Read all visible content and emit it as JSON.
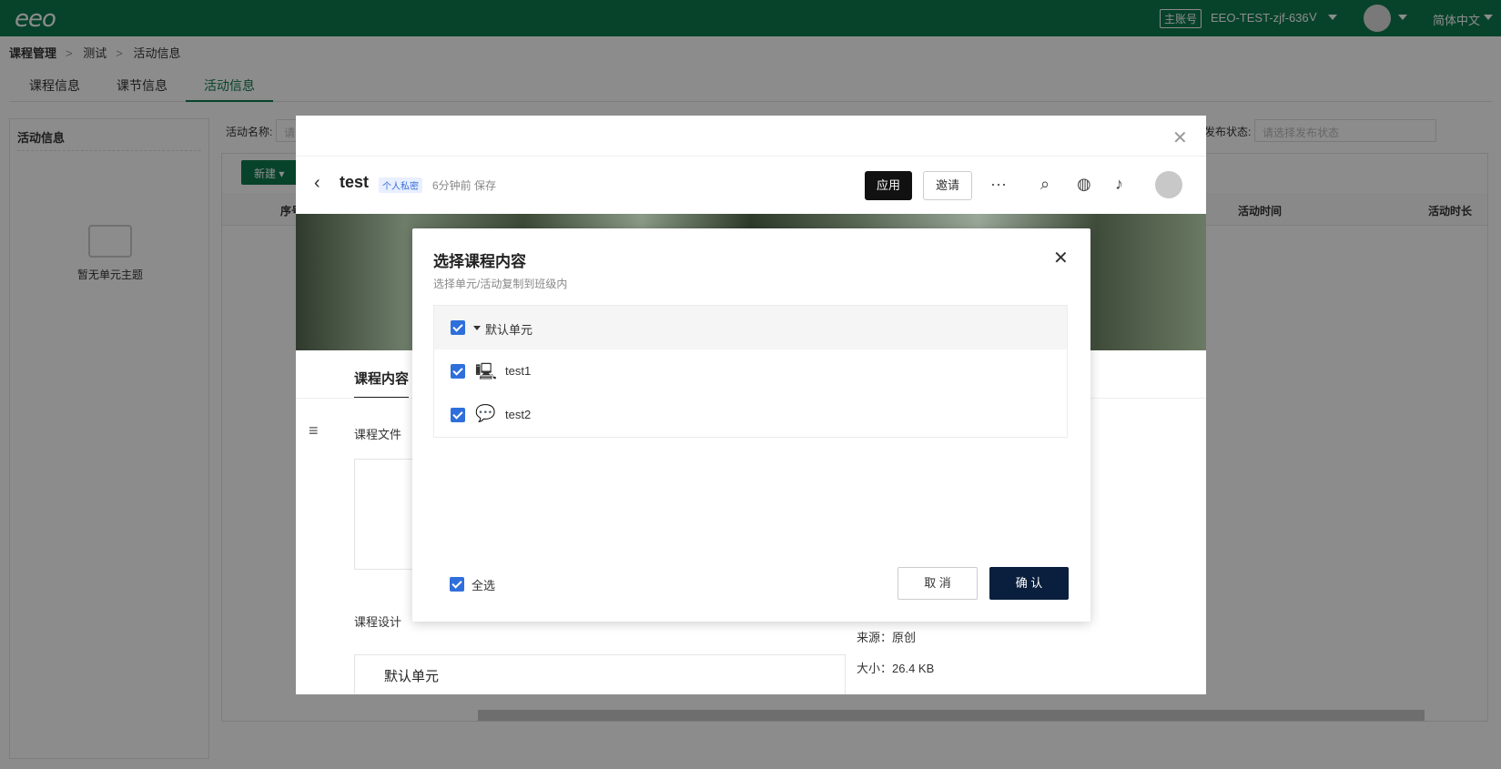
{
  "topbar": {
    "logo": "eeo",
    "account_badge": "主账号",
    "account_name": "EEO-TEST-zjf-636",
    "account_level": "V",
    "language": "简体中文"
  },
  "breadcrumb": [
    "课程管理",
    "测试",
    "活动信息"
  ],
  "tabs": [
    {
      "label": "课程信息"
    },
    {
      "label": "课节信息"
    },
    {
      "label": "活动信息"
    }
  ],
  "left_panel": {
    "title": "活动信息",
    "empty_text": "暂无单元主题"
  },
  "filters": {
    "activity_name_label": "活动名称:",
    "activity_name_placeholder": "请",
    "publish_status_label": "发布状态:",
    "publish_status_placeholder": "请选择发布状态"
  },
  "table": {
    "new_button": "新建",
    "headers": {
      "index": "序号",
      "activity_time": "活动时间",
      "activity_duration": "活动时长"
    }
  },
  "editor": {
    "title": "test",
    "private_tag": "个人私密",
    "saved_text": "6分钟前 保存",
    "apply_button": "应用",
    "invite_button": "邀请",
    "more_label": "···",
    "content_tab": "课程内容",
    "course_file_label": "课程文件",
    "course_design_label": "课程设计",
    "unit_label": "默认单元",
    "source_label": "来源：原创",
    "size_label": "大小：26.4 KB"
  },
  "dialog": {
    "title": "选择课程内容",
    "subtitle": "选择单元/活动复制到班级内",
    "tree": [
      {
        "label": "默认单元",
        "checked": true,
        "type": "unit"
      },
      {
        "label": "test1",
        "checked": true,
        "type": "lecture",
        "icon": "teacher-board-icon"
      },
      {
        "label": "test2",
        "checked": true,
        "type": "discussion",
        "icon": "chat-bubble-icon"
      }
    ],
    "select_all_label": "全选",
    "cancel_button": "取 消",
    "confirm_button": "确 认"
  },
  "colors": {
    "brand_green": "#0d7a4e",
    "checkbox_blue": "#2f6fdb",
    "confirm_navy": "#0a1f3d"
  }
}
